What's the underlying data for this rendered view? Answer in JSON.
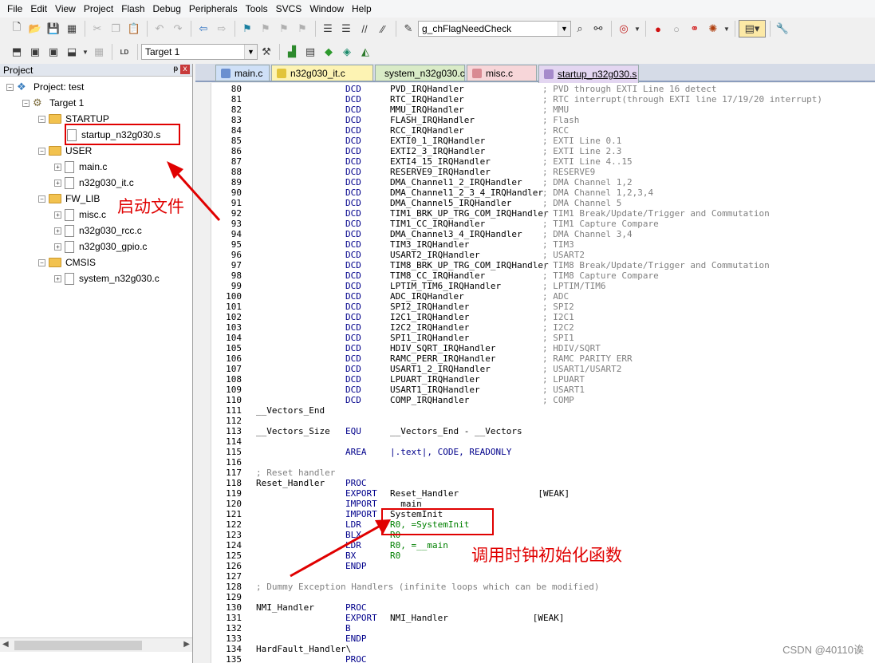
{
  "menu": [
    "File",
    "Edit",
    "View",
    "Project",
    "Flash",
    "Debug",
    "Peripherals",
    "Tools",
    "SVCS",
    "Window",
    "Help"
  ],
  "toolbar": {
    "find_value": "g_chFlagNeedCheck",
    "target_value": "Target 1"
  },
  "project_panel": {
    "title": "Project",
    "pin": "ᵽ",
    "close": "x",
    "project": "Project: test",
    "target": "Target 1",
    "groups": [
      {
        "name": "STARTUP",
        "files": [
          "startup_n32g030.s"
        ]
      },
      {
        "name": "USER",
        "files": [
          "main.c",
          "n32g030_it.c"
        ]
      },
      {
        "name": "FW_LIB",
        "files": [
          "misc.c",
          "n32g030_rcc.c",
          "n32g030_gpio.c"
        ]
      },
      {
        "name": "CMSIS",
        "files": [
          "system_n32g030.c"
        ]
      }
    ]
  },
  "tabs": [
    {
      "label": "main.c",
      "color": "#cfe0f7",
      "icon": "#6a8fd0"
    },
    {
      "label": "n32g030_it.c",
      "color": "#fdf3b3",
      "icon": "#e2c43a"
    },
    {
      "label": "system_n32g030.c",
      "color": "#d9ebc7",
      "icon": "#7fb24a"
    },
    {
      "label": "misc.c",
      "color": "#f7d6d9",
      "icon": "#d98a93"
    },
    {
      "label": "startup_n32g030.s",
      "color": "#e3d6f1",
      "icon": "#a58acb"
    }
  ],
  "code_lines": [
    [
      "80",
      "",
      "DCD",
      "PVD_IRQHandler",
      "; PVD through EXTI Line 16 detect"
    ],
    [
      "81",
      "",
      "DCD",
      "RTC_IRQHandler",
      "; RTC interrupt(through EXTI line 17/19/20 interrupt)"
    ],
    [
      "82",
      "",
      "DCD",
      "MMU_IRQHandler",
      "; MMU"
    ],
    [
      "83",
      "",
      "DCD",
      "FLASH_IRQHandler",
      "; Flash"
    ],
    [
      "84",
      "",
      "DCD",
      "RCC_IRQHandler",
      "; RCC"
    ],
    [
      "85",
      "",
      "DCD",
      "EXTI0_1_IRQHandler",
      "; EXTI Line 0.1"
    ],
    [
      "86",
      "",
      "DCD",
      "EXTI2_3_IRQHandler",
      "; EXTI Line 2.3"
    ],
    [
      "87",
      "",
      "DCD",
      "EXTI4_15_IRQHandler",
      "; EXTI Line 4..15"
    ],
    [
      "88",
      "",
      "DCD",
      "RESERVE9_IRQHandler",
      "; RESERVE9"
    ],
    [
      "89",
      "",
      "DCD",
      "DMA_Channel1_2_IRQHandler",
      "; DMA Channel 1,2"
    ],
    [
      "90",
      "",
      "DCD",
      "DMA_Channel1_2_3_4_IRQHandler",
      "; DMA Channel 1,2,3,4"
    ],
    [
      "91",
      "",
      "DCD",
      "DMA_Channel5_IRQHandler",
      "; DMA Channel 5"
    ],
    [
      "92",
      "",
      "DCD",
      "TIM1_BRK_UP_TRG_COM_IRQHandler",
      "; TIM1 Break/Update/Trigger and Commutation"
    ],
    [
      "93",
      "",
      "DCD",
      "TIM1_CC_IRQHandler",
      "; TIM1 Capture Compare"
    ],
    [
      "94",
      "",
      "DCD",
      "DMA_Channel3_4_IRQHandler",
      "; DMA Channel 3,4"
    ],
    [
      "95",
      "",
      "DCD",
      "TIM3_IRQHandler",
      "; TIM3"
    ],
    [
      "96",
      "",
      "DCD",
      "USART2_IRQHandler",
      "; USART2"
    ],
    [
      "97",
      "",
      "DCD",
      "TIM8_BRK_UP_TRG_COM_IRQHandler",
      "; TIM8 Break/Update/Trigger and Commutation"
    ],
    [
      "98",
      "",
      "DCD",
      "TIM8_CC_IRQHandler",
      "; TIM8 Capture Compare"
    ],
    [
      "99",
      "",
      "DCD",
      "LPTIM_TIM6_IRQHandler",
      "; LPTIM/TIM6"
    ],
    [
      "100",
      "",
      "DCD",
      "ADC_IRQHandler",
      "; ADC"
    ],
    [
      "101",
      "",
      "DCD",
      "SPI2_IRQHandler",
      "; SPI2"
    ],
    [
      "102",
      "",
      "DCD",
      "I2C1_IRQHandler",
      "; I2C1"
    ],
    [
      "103",
      "",
      "DCD",
      "I2C2_IRQHandler",
      "; I2C2"
    ],
    [
      "104",
      "",
      "DCD",
      "SPI1_IRQHandler",
      "; SPI1"
    ],
    [
      "105",
      "",
      "DCD",
      "HDIV_SQRT_IRQHandler",
      "; HDIV/SQRT"
    ],
    [
      "106",
      "",
      "DCD",
      "RAMC_PERR_IRQHandler",
      "; RAMC PARITY ERR"
    ],
    [
      "107",
      "",
      "DCD",
      "USART1_2_IRQHandler",
      "; USART1/USART2"
    ],
    [
      "108",
      "",
      "DCD",
      "LPUART_IRQHandler",
      "; LPUART"
    ],
    [
      "109",
      "",
      "DCD",
      "USART1_IRQHandler",
      "; USART1"
    ],
    [
      "110",
      "",
      "DCD",
      "COMP_IRQHandler",
      "; COMP"
    ],
    [
      "111",
      "__Vectors_End",
      "",
      "",
      ""
    ],
    [
      "112",
      "",
      "",
      "",
      ""
    ],
    [
      "113",
      "__Vectors_Size",
      "EQU",
      "__Vectors_End - __Vectors",
      ""
    ],
    [
      "114",
      "",
      "",
      "",
      ""
    ],
    [
      "115",
      "",
      "AREA",
      "|.text|, CODE, READONLY",
      ""
    ],
    [
      "116",
      "",
      "",
      "",
      ""
    ],
    [
      "117",
      "; Reset handler",
      "",
      "",
      ""
    ],
    [
      "118",
      "Reset_Handler",
      "PROC",
      "",
      ""
    ],
    [
      "119",
      "",
      "EXPORT",
      "Reset_Handler               [WEAK]",
      ""
    ],
    [
      "120",
      "",
      "IMPORT",
      "__main",
      ""
    ],
    [
      "121",
      "",
      "IMPORT",
      "SystemInit",
      ""
    ],
    [
      "122",
      "",
      "LDR",
      "R0, =SystemInit",
      ""
    ],
    [
      "123",
      "",
      "BLX",
      "R0",
      ""
    ],
    [
      "124",
      "",
      "LDR",
      "R0, =__main",
      ""
    ],
    [
      "125",
      "",
      "BX",
      "R0",
      ""
    ],
    [
      "126",
      "",
      "ENDP",
      "",
      ""
    ],
    [
      "127",
      "",
      "",
      "",
      ""
    ],
    [
      "128",
      "; Dummy Exception Handlers (infinite loops which can be modified)",
      "",
      "",
      ""
    ],
    [
      "129",
      "",
      "",
      "",
      ""
    ],
    [
      "130",
      "NMI_Handler",
      "PROC",
      "",
      ""
    ],
    [
      "131",
      "",
      "EXPORT",
      "NMI_Handler                [WEAK]",
      ""
    ],
    [
      "132",
      "",
      "B",
      "",
      ""
    ],
    [
      "133",
      "",
      "ENDP",
      "",
      ""
    ],
    [
      "134",
      "HardFault_Handler\\",
      "",
      "",
      ""
    ],
    [
      "135",
      "",
      "PROC",
      "",
      ""
    ]
  ],
  "annotations": {
    "startup_note": "启动文件",
    "sysinit_note": "调用时钟初始化函数"
  },
  "watermark": "CSDN @40110诶"
}
